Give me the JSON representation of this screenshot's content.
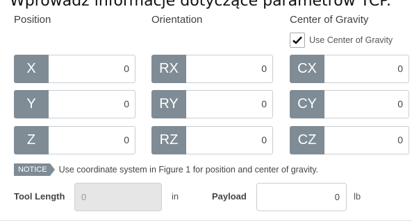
{
  "caption": "Wprowadź informacje dotyczące parametrów TCP.",
  "columns": {
    "position": "Position",
    "orientation": "Orientation",
    "center_of_gravity": "Center of Gravity"
  },
  "use_cog": {
    "label": "Use Center of Gravity",
    "checked": true
  },
  "fields": {
    "x": {
      "tag": "X",
      "value": "0"
    },
    "y": {
      "tag": "Y",
      "value": "0"
    },
    "z": {
      "tag": "Z",
      "value": "0"
    },
    "rx": {
      "tag": "RX",
      "value": "0"
    },
    "ry": {
      "tag": "RY",
      "value": "0"
    },
    "rz": {
      "tag": "RZ",
      "value": "0"
    },
    "cx": {
      "tag": "CX",
      "value": "0"
    },
    "cy": {
      "tag": "CY",
      "value": "0"
    },
    "cz": {
      "tag": "CZ",
      "value": "0"
    }
  },
  "notice": {
    "badge": "NOTICE",
    "text": "Use coordinate system in Figure 1 for position and center of gravity."
  },
  "tool_length": {
    "label": "Tool Length",
    "value": "0",
    "unit": "in"
  },
  "payload": {
    "label": "Payload",
    "value": "0",
    "unit": "lb"
  },
  "colors": {
    "tag_bg": "#7f8c95",
    "disabled_bg": "#e6e6e6"
  }
}
